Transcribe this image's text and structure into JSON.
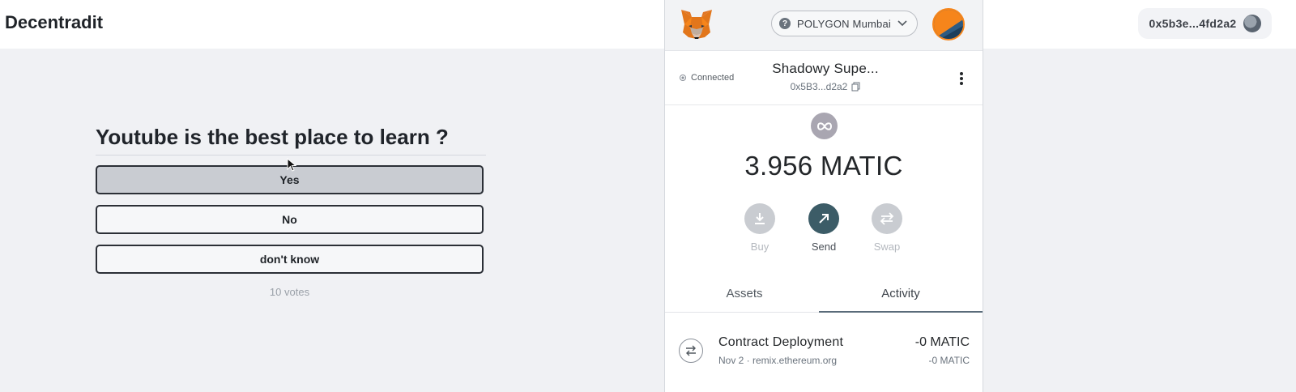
{
  "app": {
    "brand": "Decentradit"
  },
  "wallet_pill": {
    "address": "0x5b3e...4fd2a2",
    "avatar_icon": "account-avatar-icon"
  },
  "poll": {
    "question": "Youtube is the best place to learn ?",
    "options": [
      {
        "label": "Yes",
        "selected": true
      },
      {
        "label": "No",
        "selected": false
      },
      {
        "label": "don't know",
        "selected": false
      }
    ],
    "votes": "10 votes"
  },
  "metamask": {
    "network": "POLYGON Mumbai",
    "connection_status": "Connected",
    "account_name": "Shadowy Supe...",
    "account_address": "0x5B3...d2a2",
    "token_icon": "polygon-icon",
    "balance": "3.956 MATIC",
    "actions": [
      {
        "label": "Buy",
        "enabled": false,
        "icon": "download-icon"
      },
      {
        "label": "Send",
        "enabled": true,
        "icon": "arrow-up-right-icon"
      },
      {
        "label": "Swap",
        "enabled": false,
        "icon": "swap-icon"
      }
    ],
    "tabs": [
      {
        "label": "Assets",
        "active": false
      },
      {
        "label": "Activity",
        "active": true
      }
    ],
    "activity": [
      {
        "title": "Contract Deployment",
        "subtitle": "Nov 2 · remix.ethereum.org",
        "amount": "-0 MATIC",
        "amount_secondary": "-0 MATIC",
        "icon": "transfer-arrows-icon"
      }
    ],
    "colors": {
      "accent": "#f6851b",
      "send_button": "#3c5c67"
    }
  }
}
